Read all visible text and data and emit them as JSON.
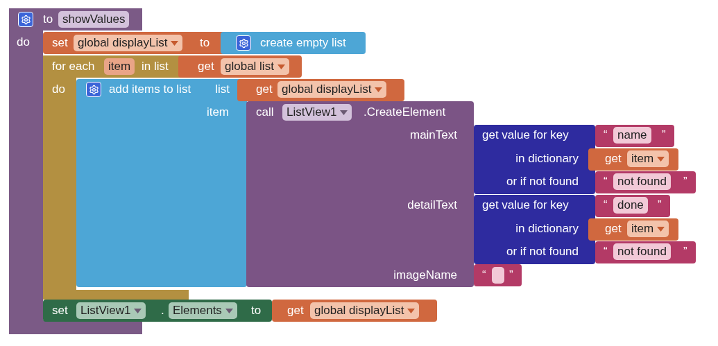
{
  "procedure": {
    "keyword": "to",
    "name": "showValues",
    "do_label": "do"
  },
  "set_display": {
    "keyword": "set",
    "variable": "global displayList",
    "to_label": "to",
    "value": "create empty list"
  },
  "for_each": {
    "keyword": "for each",
    "variable": "item",
    "in_list_label": "in list",
    "get": "get",
    "list": "global list",
    "do_label": "do"
  },
  "add_items": {
    "title": "add items to list",
    "list_label": "list",
    "item_label": "item",
    "get": "get",
    "list": "global displayList"
  },
  "call": {
    "keyword": "call",
    "component": "ListView1",
    "method": ".CreateElement",
    "main_text_label": "mainText",
    "detail_text_label": "detailText",
    "image_name_label": "imageName"
  },
  "lookups": [
    {
      "title": "get value for key",
      "open_quote": "“",
      "key": "name",
      "close_quote": "”",
      "dictionary_label": "in dictionary",
      "get": "get",
      "dictionary": "item",
      "not_found_label": "or if not found",
      "not_found": "not found"
    },
    {
      "title": "get value for key",
      "open_quote": "“",
      "key": "done",
      "close_quote": "”",
      "dictionary_label": "in dictionary",
      "get": "get",
      "dictionary": "item",
      "not_found_label": "or if not found",
      "not_found": "not found"
    }
  ],
  "image_name": {
    "open_quote": "“",
    "close_quote": "”"
  },
  "set_elements": {
    "keyword": "set",
    "component": "ListView1",
    "dot": ".",
    "property": "Elements",
    "to_label": "to",
    "get": "get",
    "value": "global displayList"
  }
}
